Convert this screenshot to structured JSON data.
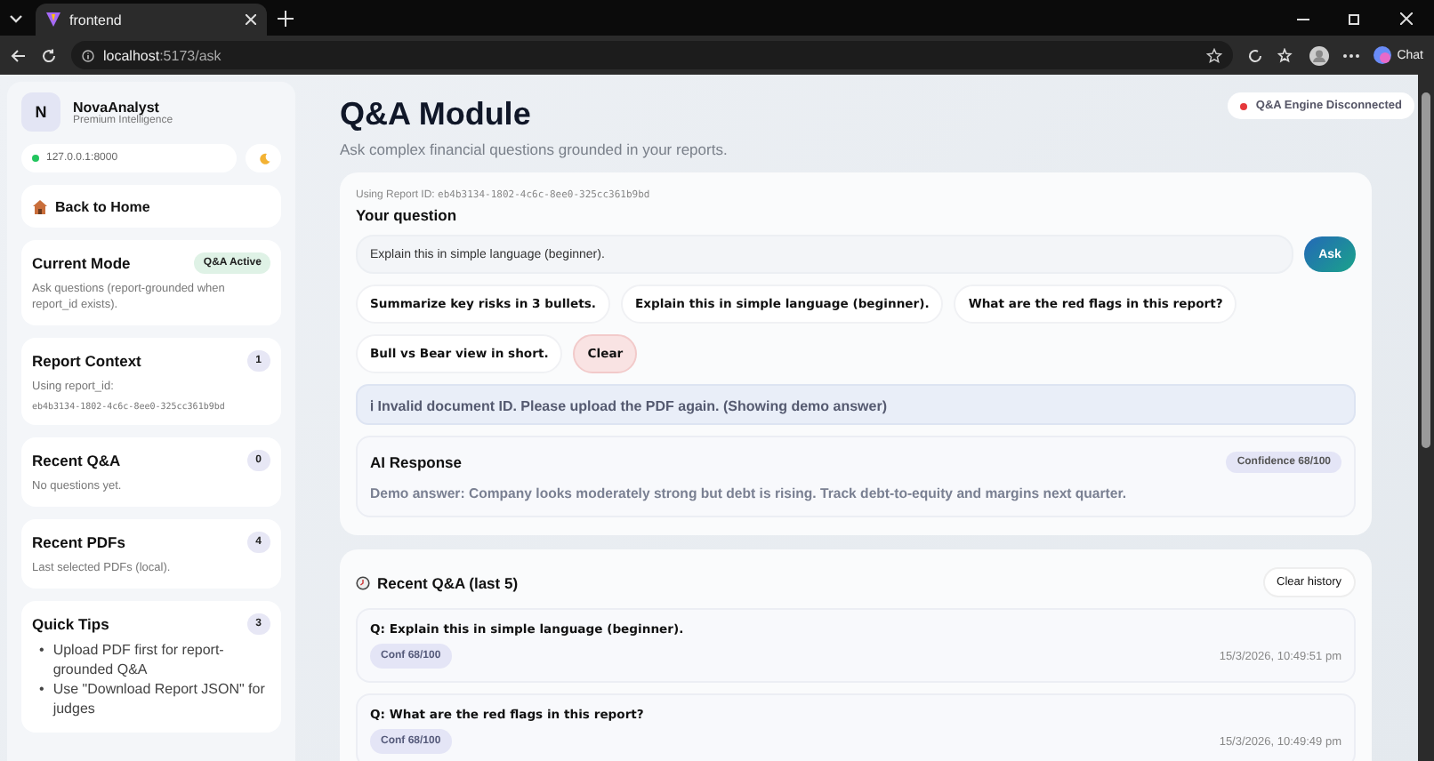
{
  "browser": {
    "tab_title": "frontend",
    "url_host": "localhost",
    "url_path": ":5173/ask",
    "chat_label": "Chat"
  },
  "sidebar": {
    "brand": {
      "initial": "N",
      "name": "NovaAnalyst",
      "tagline": "Premium Intelligence"
    },
    "server": {
      "address": "127.0.0.1:8000",
      "connected": true
    },
    "back_link": "Back to Home",
    "cards": [
      {
        "kind": "mode",
        "title": "Current Mode",
        "badge": "Q&A Active",
        "text": "Ask questions (report-grounded when report_id exists)."
      },
      {
        "kind": "context",
        "title": "Report Context",
        "badge": "1",
        "text": "Using report_id:",
        "code": "eb4b3134-1802-4c6c-8ee0-325cc361b9bd"
      },
      {
        "kind": "plain",
        "title": "Recent Q&A",
        "badge": "0",
        "text": "No questions yet."
      },
      {
        "kind": "plain",
        "title": "Recent PDFs",
        "badge": "4",
        "text": "Last selected PDFs (local)."
      },
      {
        "kind": "tips",
        "title": "Quick Tips",
        "badge": "3",
        "marker": "•",
        "items": [
          "Upload PDF first for report-grounded Q&A",
          "Use \"Download Report JSON\" for judges"
        ]
      }
    ]
  },
  "header": {
    "title": "Q&A Module",
    "subtitle": "Ask complex financial questions grounded in your reports.",
    "engine_status": {
      "label": "Q&A Engine Disconnected",
      "connected": false
    }
  },
  "ask": {
    "report_label": "Using Report ID:",
    "report_id": "eb4b3134-1802-4c6c-8ee0-325cc361b9bd",
    "question_label": "Your question",
    "question_value": "Explain this in simple language (beginner).",
    "ask_button": "Ask",
    "suggestions": [
      {
        "kind": "prompt",
        "label": "Summarize key risks in 3 bullets."
      },
      {
        "kind": "prompt",
        "label": "Explain this in simple language (beginner)."
      },
      {
        "kind": "prompt",
        "label": "What are the red flags in this report?"
      },
      {
        "kind": "prompt",
        "label": "Bull vs Bear view in short."
      },
      {
        "kind": "clear",
        "label": "Clear"
      }
    ],
    "notice": "ℹ Invalid document ID. Please upload the PDF again. (Showing demo answer)",
    "response": {
      "title": "AI Response",
      "confidence": "Confidence 68/100",
      "text": "Demo answer: Company looks moderately strong but debt is rising. Track debt-to-equity and margins next quarter."
    }
  },
  "history": {
    "title": "Recent Q&A (last 5)",
    "clear_button": "Clear history",
    "items": [
      {
        "question": "Q: Explain this in simple language (beginner).",
        "confidence": "Conf 68/100",
        "time": "15/3/2026, 10:49:51 pm"
      },
      {
        "question": "Q: What are the red flags in this report?",
        "confidence": "Conf 68/100",
        "time": "15/3/2026, 10:49:49 pm"
      }
    ]
  }
}
